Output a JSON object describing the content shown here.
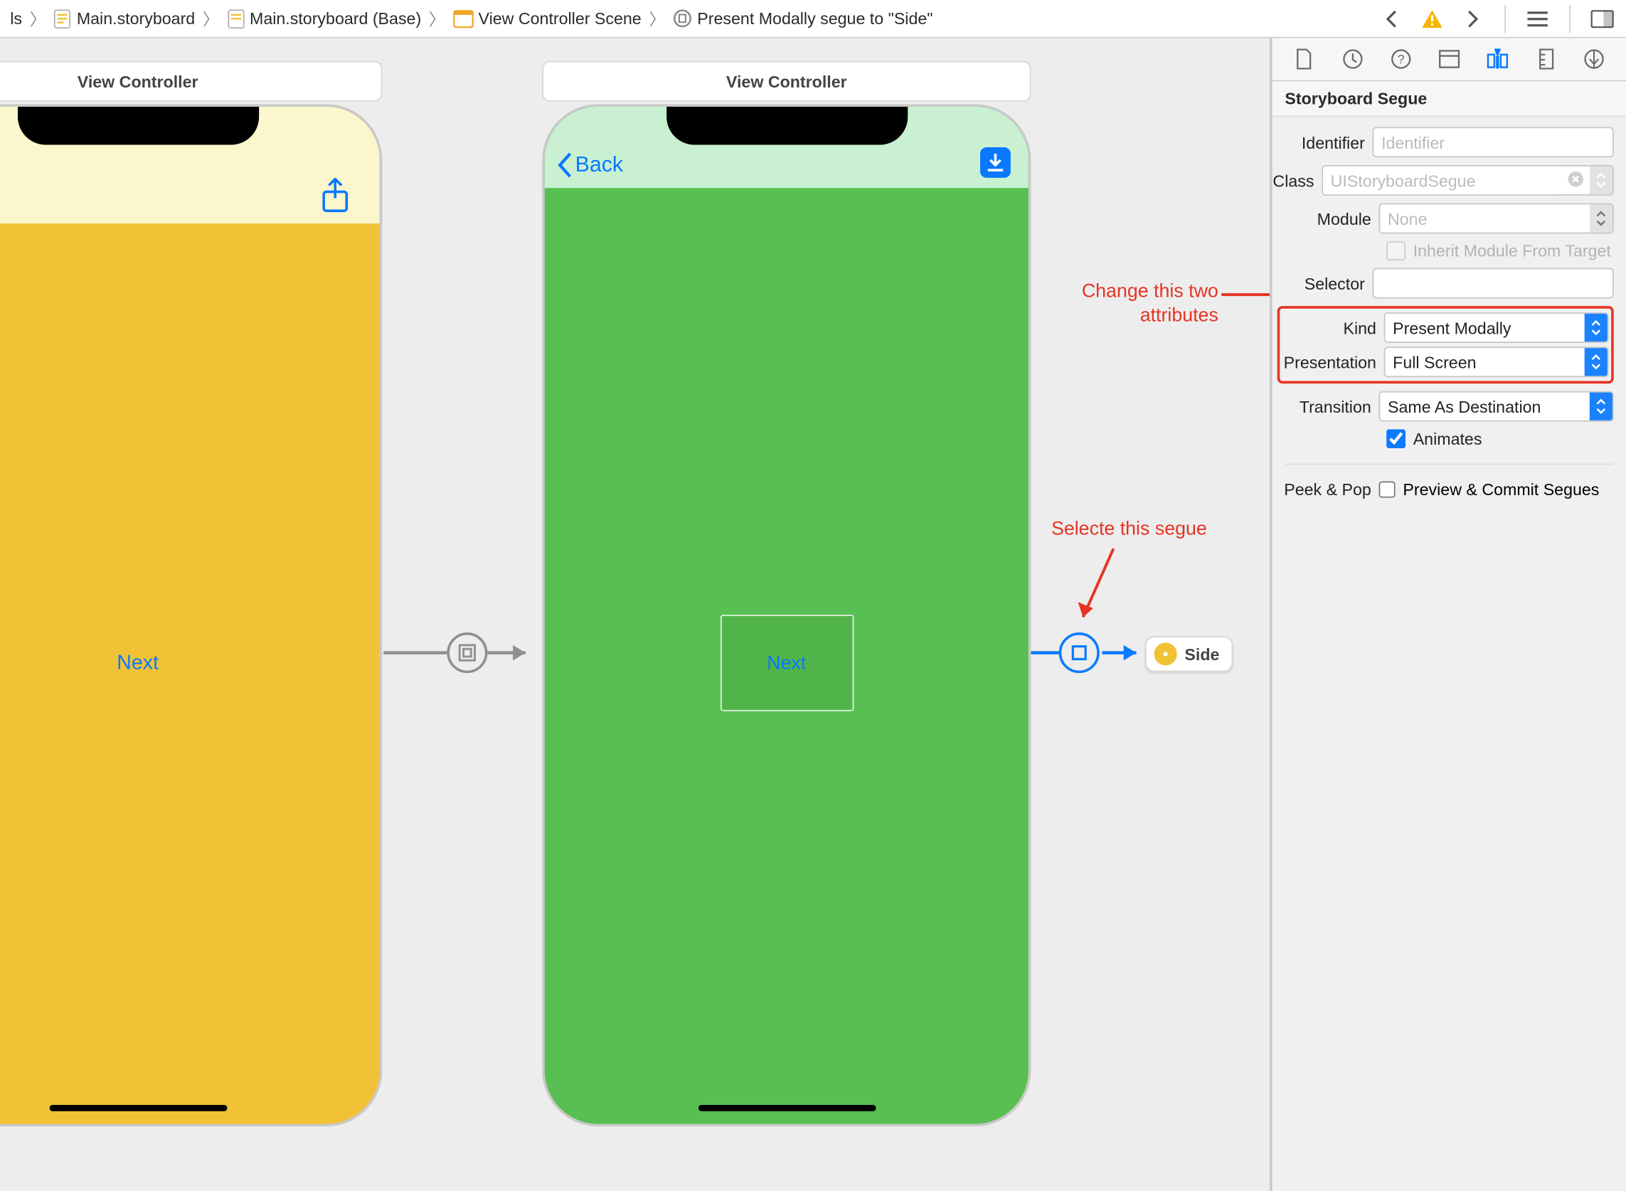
{
  "breadcrumb": {
    "item0": "ls",
    "item1": "Main.storyboard",
    "item2": "Main.storyboard (Base)",
    "item3": "View Controller Scene",
    "item4": "Present Modally segue to \"Side\""
  },
  "canvas": {
    "scene1": {
      "title": "View Controller",
      "button": "Next"
    },
    "scene2": {
      "title": "View Controller",
      "back": "Back",
      "button": "Next"
    },
    "sideChip": "Side"
  },
  "annotations": {
    "attrs_line1": "Change this two",
    "attrs_line2": "attributes",
    "segue": "Selecte this segue"
  },
  "inspector": {
    "heading": "Storyboard Segue",
    "labels": {
      "identifier": "Identifier",
      "class": "Class",
      "module": "Module",
      "inherit": "Inherit Module From Target",
      "selector": "Selector",
      "kind": "Kind",
      "presentation": "Presentation",
      "transition": "Transition",
      "animates": "Animates",
      "peek": "Peek & Pop",
      "preview": "Preview & Commit Segues"
    },
    "values": {
      "identifier_ph": "Identifier",
      "class_ph": "UIStoryboardSegue",
      "module_ph": "None",
      "kind": "Present Modally",
      "presentation": "Full Screen",
      "transition": "Same As Destination"
    }
  }
}
